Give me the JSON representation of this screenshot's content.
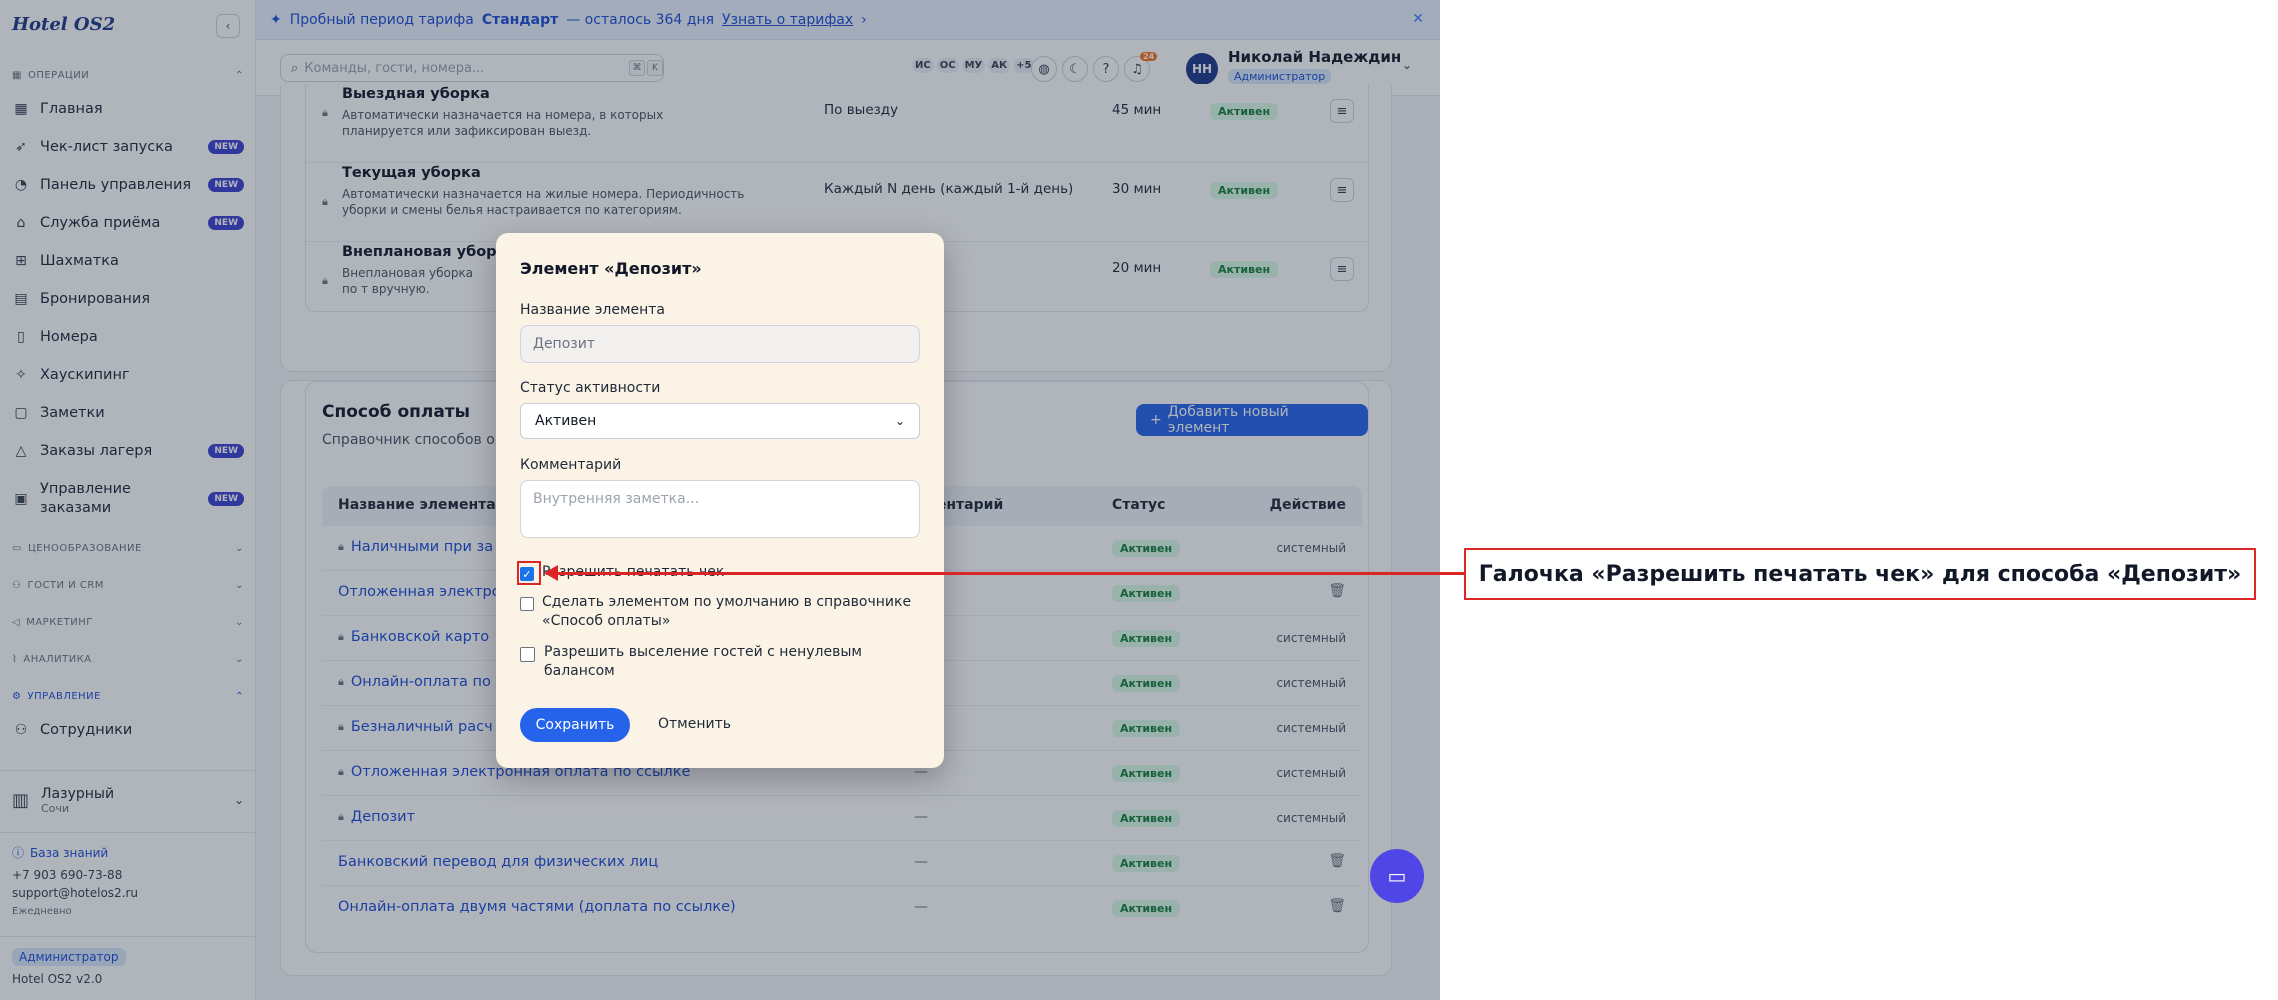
{
  "app": {
    "brand": "Hotel OS2"
  },
  "banner": {
    "prefix": "Пробный период тарифа",
    "plan": "Стандарт",
    "suffix": "— осталось 364 дня",
    "link": "Узнать о тарифах",
    "link_arrow": "›",
    "close": "✕"
  },
  "header": {
    "search_placeholder": "Команды, гости, номера...",
    "kbd": [
      "⌘",
      "K"
    ],
    "users": [
      "ИС",
      "ОС",
      "МУ",
      "АК",
      "+5"
    ],
    "notif_count": "24",
    "avatar": "НН",
    "user_name": "Николай Надеждин",
    "user_role": "Администратор"
  },
  "sidebar": {
    "sections": {
      "operations": "ОПЕРАЦИИ",
      "pricing": "ЦЕНООБРАЗОВАНИЕ",
      "guests": "ГОСТИ И CRM",
      "marketing": "МАРКЕТИНГ",
      "analytics": "АНАЛИТИКА",
      "management": "УПРАВЛЕНИЕ"
    },
    "items": [
      {
        "label": "Главная"
      },
      {
        "label": "Чек-лист запуска",
        "badge": "NEW"
      },
      {
        "label": "Панель управления",
        "badge": "NEW"
      },
      {
        "label": "Служба приёма",
        "badge": "NEW"
      },
      {
        "label": "Шахматка"
      },
      {
        "label": "Бронирования"
      },
      {
        "label": "Номера"
      },
      {
        "label": "Хаускипинг"
      },
      {
        "label": "Заметки"
      },
      {
        "label": "Заказы лагеря",
        "badge": "NEW"
      },
      {
        "label": "Управление",
        "label2": "заказами",
        "badge": "NEW"
      }
    ],
    "staff": "Сотрудники",
    "hotel": {
      "name": "Лазурный",
      "city": "Сочи"
    },
    "knowledge_base": "База знаний",
    "phone": "+7 903 690-73-88",
    "email": "support@hotelos2.ru",
    "schedule": "Ежедневно",
    "role": "Администратор",
    "version": "Hotel OS2 v2.0"
  },
  "cleaning": {
    "rows": [
      {
        "title": "Выездная уборка",
        "desc": "Автоматически назначается на номера, в которых планируется или зафиксирован выезд.",
        "period": "По выезду",
        "duration": "45 мин",
        "status": "Активен"
      },
      {
        "title": "Текущая уборка",
        "desc": "Автоматически назначается на жилые номера. Периодичность уборки и смены белья настраивается по категориям.",
        "period": "Каждый N день (каждый 1-й день)",
        "duration": "30 мин",
        "status": "Активен"
      },
      {
        "title": "Внеплановая уборка",
        "desc": "Внеплановая уборка по т вручную.",
        "period": "",
        "duration": "20 мин",
        "status": "Активен"
      }
    ]
  },
  "payment": {
    "title": "Способ оплаты",
    "desc": "Справочник способов оп                                                                             онированиях. Вы можете добавить собственные",
    "add_button": "Добавить новый элемент",
    "columns": [
      "Название элемента",
      "мментарий",
      "Статус",
      "Действие"
    ],
    "rows": [
      {
        "name": "Наличными при за",
        "comment": "",
        "status": "Активен",
        "action": "системный",
        "locked": true
      },
      {
        "name": "Отложенная электро",
        "comment": "",
        "status": "Активен",
        "action": "",
        "locked": false
      },
      {
        "name": "Банковской карто",
        "comment": "",
        "status": "Активен",
        "action": "системный",
        "locked": true
      },
      {
        "name": "Онлайн-оплата по",
        "comment": "",
        "status": "Активен",
        "action": "системный",
        "locked": true
      },
      {
        "name": "Безналичный расч",
        "comment": "",
        "status": "Активен",
        "action": "системный",
        "locked": true
      },
      {
        "name": "Отложенная электронная оплата по ссылке",
        "comment": "—",
        "status": "Активен",
        "action": "системный",
        "locked": true
      },
      {
        "name": "Депозит",
        "comment": "—",
        "status": "Активен",
        "action": "системный",
        "locked": true
      },
      {
        "name": "Банковский перевод для физических лиц",
        "comment": "—",
        "status": "Активен",
        "action": "",
        "locked": false
      },
      {
        "name": "Онлайн-оплата двумя частями (доплата по ссылке)",
        "comment": "—",
        "status": "Активен",
        "action": "",
        "locked": false
      }
    ]
  },
  "dialog": {
    "title": "Элемент «Депозит»",
    "name_label": "Название элемента",
    "name_value": "Депозит",
    "status_label": "Статус активности",
    "status_value": "Активен",
    "comment_label": "Комментарий",
    "comment_placeholder": "Внутренняя заметка...",
    "check_print": "Разрешить печатать чек",
    "check_default": "Сделать элементом по умолчанию в справочнике «Способ оплаты»",
    "check_balance": "Разрешить выселение гостей с ненулевым балансом",
    "save": "Сохранить",
    "cancel": "Отменить"
  },
  "annotation": {
    "text": "Галочка «Разрешить печатать чек» для способа «Депозит»"
  },
  "colors": {
    "accent": "#2563eb",
    "new_badge": "#3b3fd1",
    "status_green": "#15803d",
    "annotation_red": "#dc2626"
  }
}
